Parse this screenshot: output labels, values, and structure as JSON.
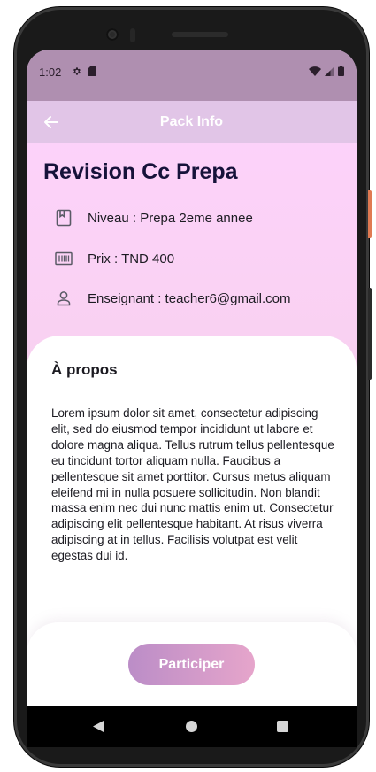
{
  "status_bar": {
    "time": "1:02",
    "icons_left": [
      "gear-icon",
      "sd-card-icon"
    ],
    "icons_right": [
      "wifi-icon",
      "signal-icon",
      "battery-icon"
    ]
  },
  "app_bar": {
    "title": "Pack Info",
    "back_icon": "arrow-left-icon"
  },
  "course": {
    "title": "Revision Cc Prepa",
    "info": [
      {
        "icon": "book-icon",
        "text": "Niveau : Prepa 2eme annee"
      },
      {
        "icon": "barcode-icon",
        "text": "Prix : TND 400"
      },
      {
        "icon": "person-icon",
        "text": "Enseignant : teacher6@gmail.com"
      }
    ]
  },
  "about": {
    "title": "À propos",
    "text": "Lorem ipsum dolor sit amet, consectetur adipiscing elit, sed do eiusmod tempor incididunt ut labore et dolore magna aliqua. Tellus rutrum tellus pellentesque eu tincidunt tortor aliquam nulla. Faucibus a pellentesque sit amet porttitor. Cursus metus aliquam eleifend mi in nulla posuere sollicitudin. Non blandit massa enim nec dui nunc mattis enim ut. Consectetur adipiscing elit pellentesque habitant. At risus viverra adipiscing at in tellus. Facilisis volutpat est velit egestas dui id."
  },
  "actions": {
    "participate_label": "Participer"
  },
  "colors": {
    "status_bar": "#af8fb0",
    "app_bar": "#e1c5e7",
    "title_text": "#16123a",
    "button_start": "#bb8dc7",
    "button_end": "#e6a5cb"
  }
}
